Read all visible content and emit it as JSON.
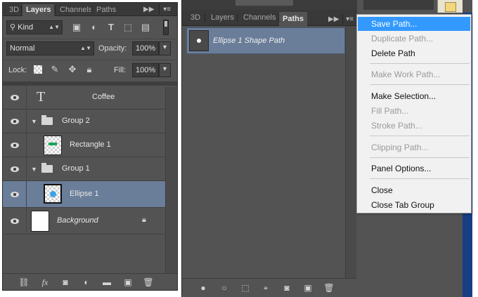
{
  "layers_panel": {
    "tabs": [
      "3D",
      "Layers",
      "Channels",
      "Paths"
    ],
    "active_tab": "Layers",
    "filter_kind": "Kind",
    "blend_mode": "Normal",
    "opacity_label": "Opacity:",
    "opacity_value": "100%",
    "lock_label": "Lock:",
    "fill_label": "Fill:",
    "fill_value": "100%",
    "layers": [
      {
        "name": "Coffee",
        "kind": "text"
      },
      {
        "name": "Group 2",
        "kind": "group"
      },
      {
        "name": "Rectangle 1",
        "kind": "shape"
      },
      {
        "name": "Group 1",
        "kind": "group"
      },
      {
        "name": "Ellipse 1",
        "kind": "shape",
        "selected": true
      },
      {
        "name": "Background",
        "kind": "background",
        "locked": true
      }
    ]
  },
  "paths_panel": {
    "tabs": [
      "3D",
      "Layers",
      "Channels",
      "Paths"
    ],
    "active_tab": "Paths",
    "paths": [
      {
        "name": "Ellipse 1 Shape Path",
        "selected": true
      }
    ]
  },
  "context_menu": {
    "items": [
      {
        "label": "Save Path...",
        "enabled": true,
        "highlighted": true
      },
      {
        "label": "Duplicate Path...",
        "enabled": false
      },
      {
        "label": "Delete Path",
        "enabled": true
      },
      {
        "label": "Make Work Path...",
        "enabled": false
      },
      {
        "label": "Make Selection...",
        "enabled": true
      },
      {
        "label": "Fill Path...",
        "enabled": false
      },
      {
        "label": "Stroke Path...",
        "enabled": false
      },
      {
        "label": "Clipping Path...",
        "enabled": false
      },
      {
        "label": "Panel Options...",
        "enabled": true
      },
      {
        "label": "Close",
        "enabled": true
      },
      {
        "label": "Close Tab Group",
        "enabled": true
      }
    ]
  },
  "colors": {
    "panel_bg": "#535353",
    "selection": "#6a7d99",
    "menu_highlight": "#3399ff"
  }
}
